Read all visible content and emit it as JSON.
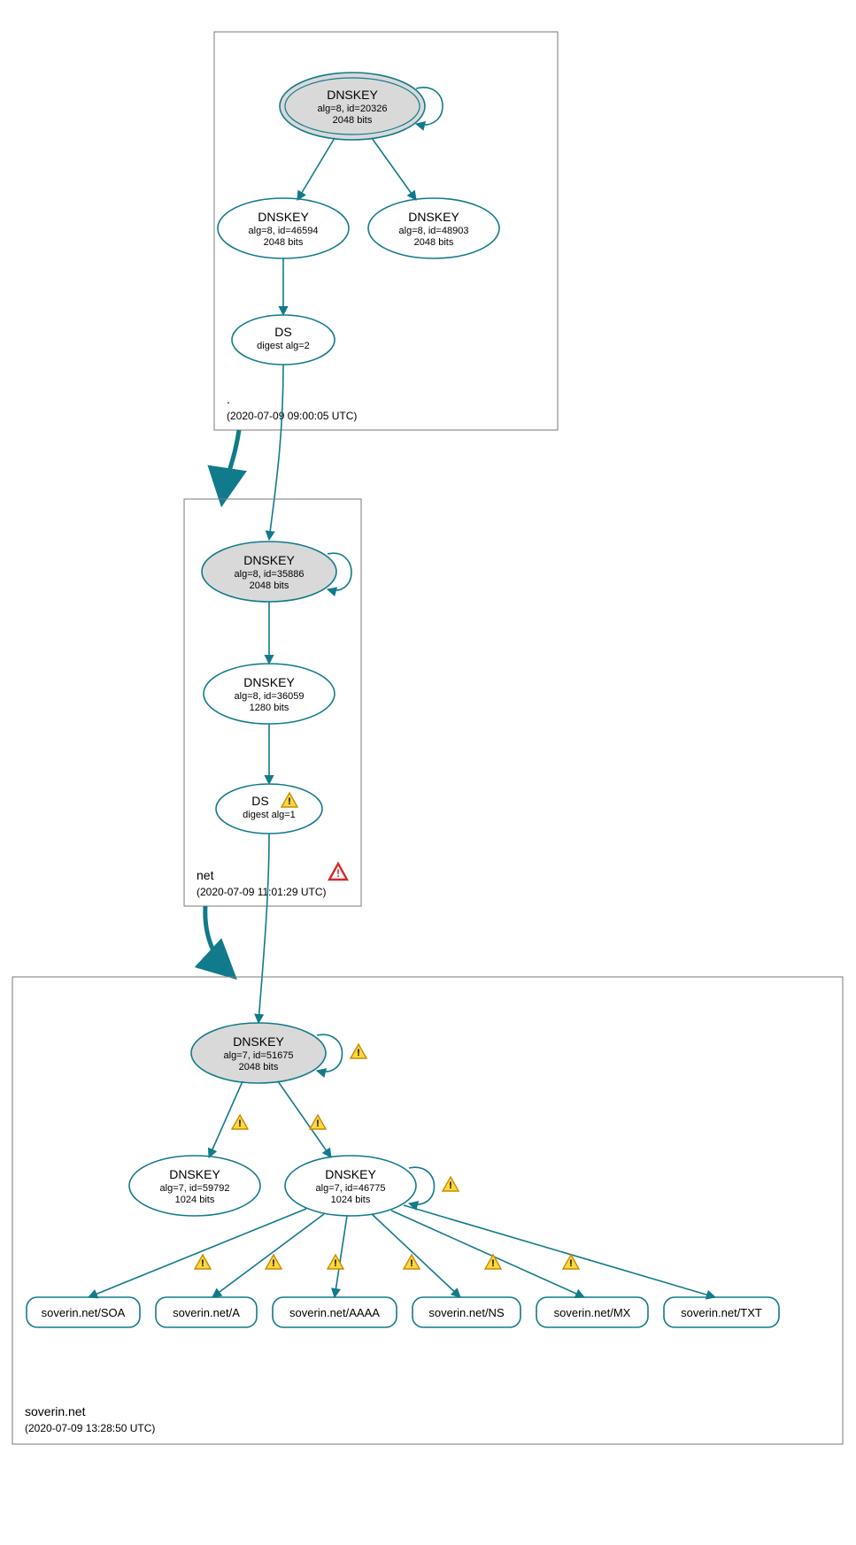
{
  "colors": {
    "stroke": "#117a8b",
    "fillGrey": "#d9d9d9",
    "fillWhite": "#ffffff",
    "boxStroke": "#7a7a7a",
    "warnFill": "#ffd83d",
    "warnStroke": "#c98a00",
    "errFill": "#ffffff",
    "errStroke": "#d42a2a"
  },
  "zones": {
    "root": {
      "name": ".",
      "timestamp": "(2020-07-09 09:00:05 UTC)"
    },
    "net": {
      "name": "net",
      "timestamp": "(2020-07-09 11:01:29 UTC)"
    },
    "soverin": {
      "name": "soverin.net",
      "timestamp": "(2020-07-09 13:28:50 UTC)"
    }
  },
  "nodes": {
    "root_ksk": {
      "title": "DNSKEY",
      "line2": "alg=8, id=20326",
      "line3": "2048 bits"
    },
    "root_zsk1": {
      "title": "DNSKEY",
      "line2": "alg=8, id=46594",
      "line3": "2048 bits"
    },
    "root_zsk2": {
      "title": "DNSKEY",
      "line2": "alg=8, id=48903",
      "line3": "2048 bits"
    },
    "root_ds": {
      "title": "DS",
      "line2": "digest alg=2",
      "line3": ""
    },
    "net_ksk": {
      "title": "DNSKEY",
      "line2": "alg=8, id=35886",
      "line3": "2048 bits"
    },
    "net_zsk": {
      "title": "DNSKEY",
      "line2": "alg=8, id=36059",
      "line3": "1280 bits"
    },
    "net_ds": {
      "title": "DS",
      "line2": "digest alg=1",
      "line3": ""
    },
    "sov_ksk": {
      "title": "DNSKEY",
      "line2": "alg=7, id=51675",
      "line3": "2048 bits"
    },
    "sov_zsk1": {
      "title": "DNSKEY",
      "line2": "alg=7, id=59792",
      "line3": "1024 bits"
    },
    "sov_zsk2": {
      "title": "DNSKEY",
      "line2": "alg=7, id=46775",
      "line3": "1024 bits"
    }
  },
  "rrsets": {
    "soa": "soverin.net/SOA",
    "a": "soverin.net/A",
    "aaaa": "soverin.net/AAAA",
    "ns": "soverin.net/NS",
    "mx": "soverin.net/MX",
    "txt": "soverin.net/TXT"
  }
}
